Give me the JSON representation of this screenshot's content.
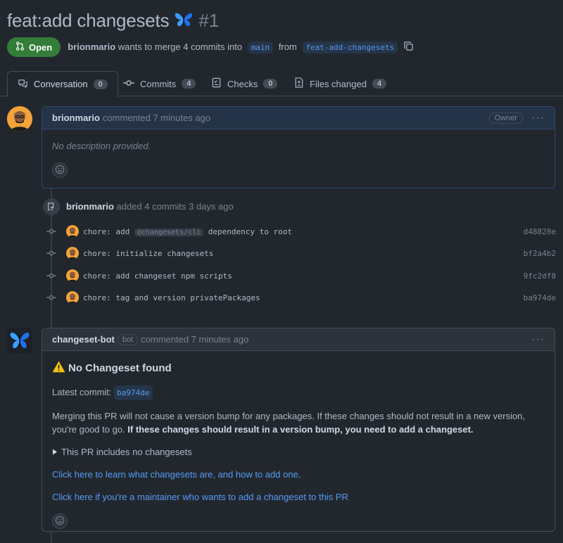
{
  "pr": {
    "title": "feat:add changesets",
    "number": "#1",
    "state": "Open",
    "author": "brionmario",
    "merge_text": "wants to merge 4 commits into",
    "base_branch": "main",
    "from_text": "from",
    "head_branch": "feat-add-changesets"
  },
  "tabs": [
    {
      "label": "Conversation",
      "count": "0"
    },
    {
      "label": "Commits",
      "count": "4"
    },
    {
      "label": "Checks",
      "count": "0"
    },
    {
      "label": "Files changed",
      "count": "4"
    }
  ],
  "first_comment": {
    "author": "brionmario",
    "meta": "commented 7 minutes ago",
    "role": "Owner",
    "body": "No description provided."
  },
  "commits_event": {
    "author": "brionmario",
    "text": "added 4 commits 3 days ago",
    "commits": [
      {
        "pre": "chore: add ",
        "chip": "@changesets/cli",
        "post": " dependency to root",
        "sha": "d48828e"
      },
      {
        "pre": "chore: initialize changesets",
        "chip": "",
        "post": "",
        "sha": "bf2a4b2"
      },
      {
        "pre": "chore: add changeset npm scripts",
        "chip": "",
        "post": "",
        "sha": "9fc2df8"
      },
      {
        "pre": "chore: tag and version privatePackages",
        "chip": "",
        "post": "",
        "sha": "ba974de"
      }
    ]
  },
  "bot_comment": {
    "author": "changeset-bot",
    "badge": "bot",
    "meta": "commented 7 minutes ago",
    "heading": "No Changeset found",
    "latest_label": "Latest commit:",
    "latest_sha": "ba974de",
    "para_normal": "Merging this PR will not cause a version bump for any packages. If these changes should not result in a new version, you're good to go. ",
    "para_bold": "If these changes should result in a version bump, you need to add a changeset.",
    "details": "This PR includes no changesets",
    "link1": "Click here to learn what changesets are, and how to add one",
    "link1_suffix": ".",
    "link2": "Click here if you're a maintainer who wants to add a changeset to this PR"
  },
  "colors": {
    "bg": "#22272e",
    "accent": "#539bf5",
    "open_green": "#347d39",
    "butterfly": "#3b9eff"
  }
}
